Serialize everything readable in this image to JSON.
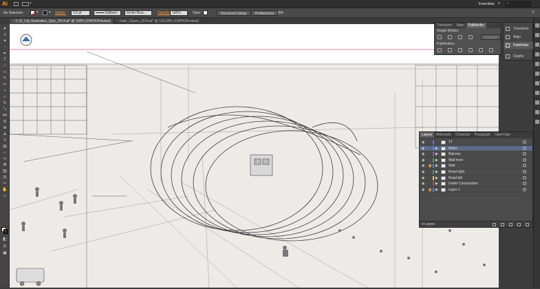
{
  "app": {
    "logo": "Ai",
    "workspace": "Essentials"
  },
  "control_bar": {
    "selection": "No Selection",
    "stroke_label": "Stroke:",
    "stroke_weight": "0.5 pt",
    "profile": "Uniform",
    "brush": "6d Art Brus...",
    "opacity_label": "Opacity:",
    "opacity": "100%",
    "style_label": "Style:",
    "document_setup": "Document Setup",
    "preferences": "Preferences"
  },
  "doc_tabs": [
    {
      "label": "0-10_City Illustration_2july_2014.ai* @ 100% (CMYK/Preview)"
    },
    {
      "label": "chart_21june_2014.ai* @ 103.39% (CMYK/Preview)"
    }
  ],
  "pathfinder_panel": {
    "tabs": [
      "Transform",
      "Align",
      "Pathfinder"
    ],
    "shape_modes": "Shape Modes:",
    "expand": "Expand",
    "pathfinders": "Pathfinders:"
  },
  "dock": {
    "items": [
      {
        "label": "Transform",
        "icon": "transform-icon"
      },
      {
        "label": "Align",
        "icon": "align-icon"
      },
      {
        "label": "Pathfinder",
        "icon": "pathfinder-icon"
      },
      {
        "label": "Glyphs",
        "icon": "glyphs-icon"
      }
    ]
  },
  "layers_panel": {
    "tabs": [
      "Layers",
      "Artboards",
      "Character",
      "Paragraph",
      "OpenType"
    ],
    "layers": [
      {
        "name": "TT",
        "color": "#4f7fff",
        "selected": false,
        "locked": false,
        "has_arrow": false
      },
      {
        "name": "Metro",
        "color": "#4f7fff",
        "selected": true,
        "locked": false,
        "has_arrow": true
      },
      {
        "name": "Balcony",
        "color": "#a84fd8",
        "selected": false,
        "locked": false,
        "has_arrow": true
      },
      {
        "name": "Wall front",
        "color": "#2fb24a",
        "selected": false,
        "locked": false,
        "has_arrow": true
      },
      {
        "name": "Wall",
        "color": "#4f7fff",
        "selected": false,
        "locked": true,
        "has_arrow": true
      },
      {
        "name": "Road right",
        "color": "#2fb24a",
        "selected": false,
        "locked": false,
        "has_arrow": true
      },
      {
        "name": "Road left",
        "color": "#e0d03a",
        "selected": false,
        "locked": false,
        "has_arrow": true
      },
      {
        "name": "Under Construction",
        "color": "#d8404a",
        "selected": false,
        "locked": false,
        "has_arrow": true
      },
      {
        "name": "Layer 1",
        "color": "#4f7fff",
        "selected": false,
        "locked": true,
        "has_arrow": true
      }
    ],
    "count": "9 Layers"
  },
  "colors": {
    "selection": "#5c6a86",
    "artboard": "#ecebe8",
    "guide": "#ff5a7a"
  }
}
